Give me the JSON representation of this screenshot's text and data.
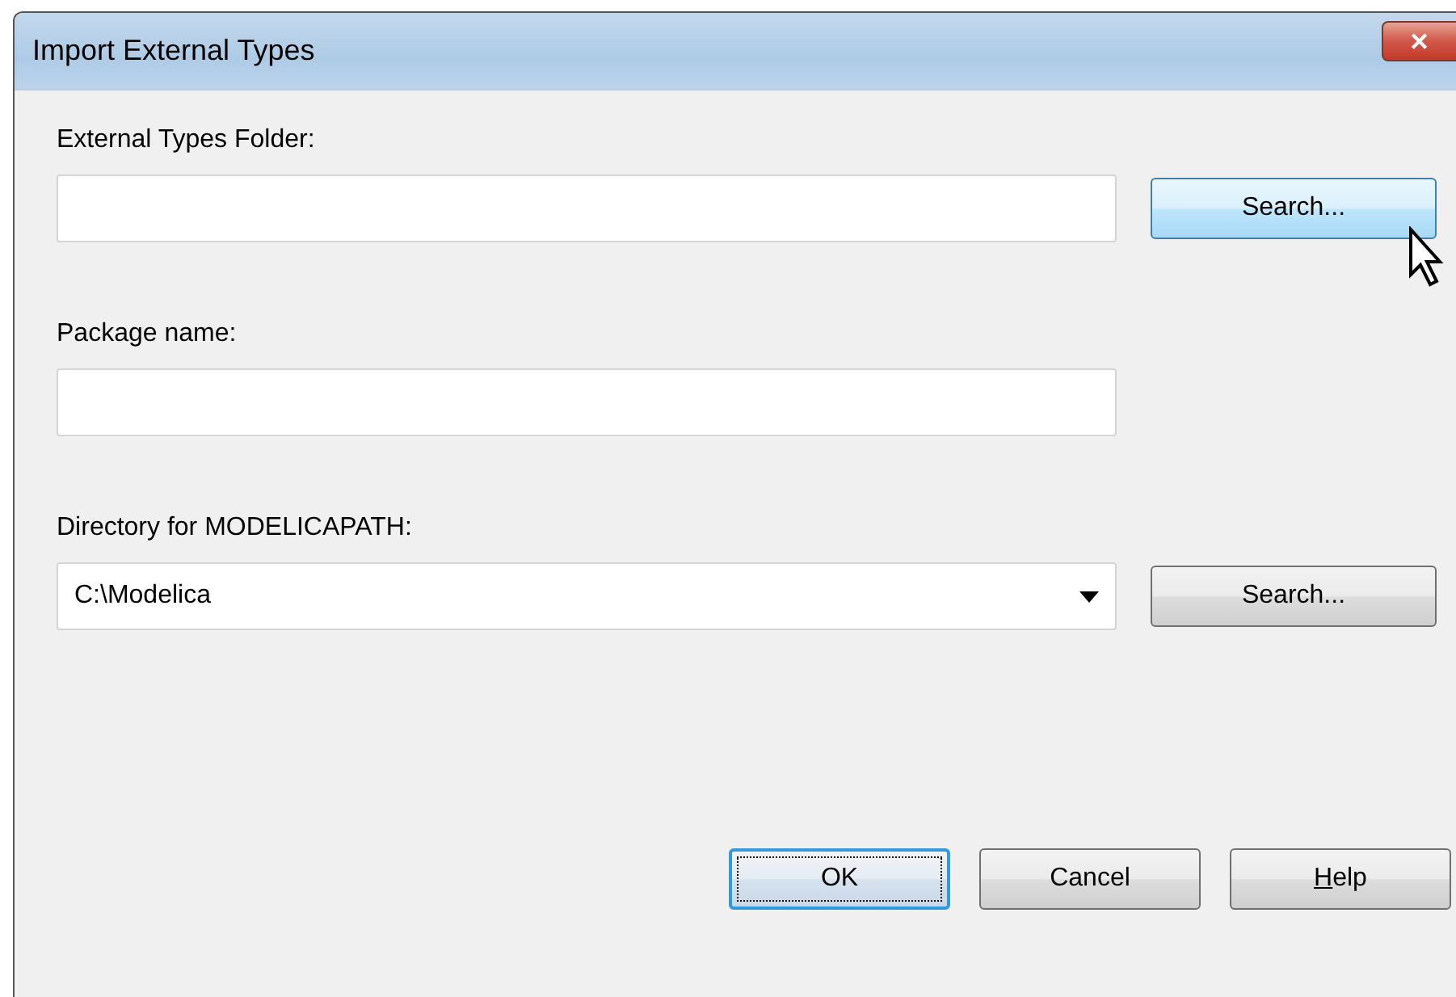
{
  "window": {
    "title": "Import External Types",
    "close_button": "✕"
  },
  "fields": [
    {
      "kind": "text",
      "label": "External Types Folder:",
      "button": {
        "label": "Search...",
        "hover": true
      }
    },
    {
      "kind": "text",
      "label": "Package name:"
    },
    {
      "kind": "combo",
      "label": "Directory for MODELICAPATH:",
      "value": "C:\\Modelica",
      "button": {
        "label": "Search...",
        "hover": false
      }
    }
  ],
  "buttons": [
    {
      "label": "OK",
      "default": true,
      "mnemonic": false
    },
    {
      "label": "Cancel",
      "default": false,
      "mnemonic": false
    },
    {
      "label": "Help",
      "default": false,
      "mnemonic": true
    }
  ]
}
